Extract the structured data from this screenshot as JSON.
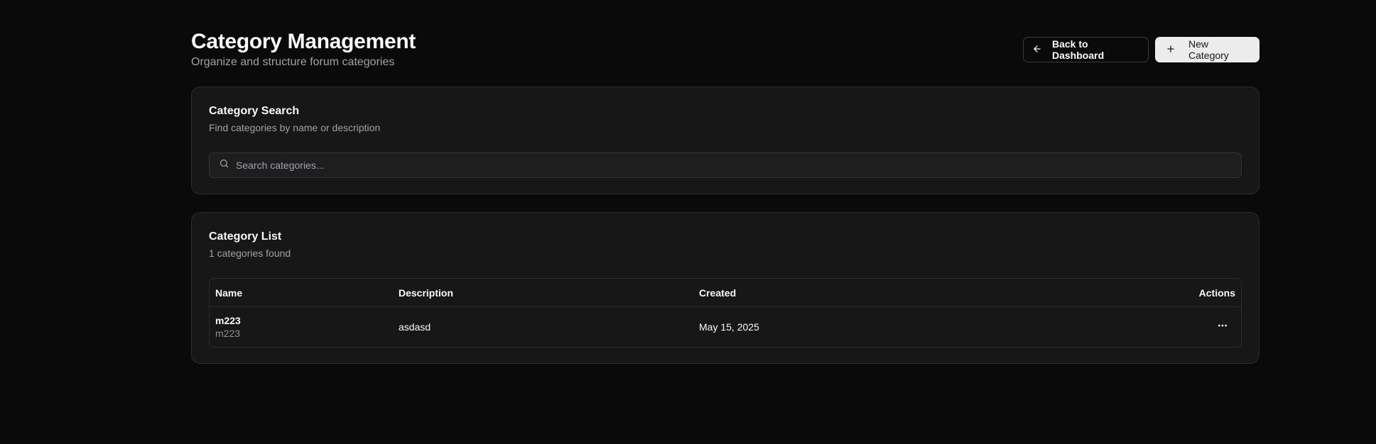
{
  "header": {
    "title": "Category Management",
    "subtitle": "Organize and structure forum categories",
    "back_button": "Back to Dashboard",
    "new_button": "New Category"
  },
  "search_card": {
    "title": "Category Search",
    "description": "Find categories by name or description",
    "placeholder": "Search categories..."
  },
  "list_card": {
    "title": "Category List",
    "count_text": "1 categories found",
    "columns": {
      "name": "Name",
      "description": "Description",
      "created": "Created",
      "actions": "Actions"
    },
    "rows": [
      {
        "name": "m223",
        "slug": "m223",
        "description": "asdasd",
        "created": "May 15, 2025"
      }
    ]
  },
  "icons": {
    "back": "arrow-left-icon",
    "new": "plus-icon",
    "search": "search-icon",
    "actions": "more-horizontal-icon"
  },
  "colors": {
    "background": "#0a0a0a",
    "card": "#171717",
    "primary_button": "#ececec",
    "muted_text": "#a1a1aa"
  }
}
